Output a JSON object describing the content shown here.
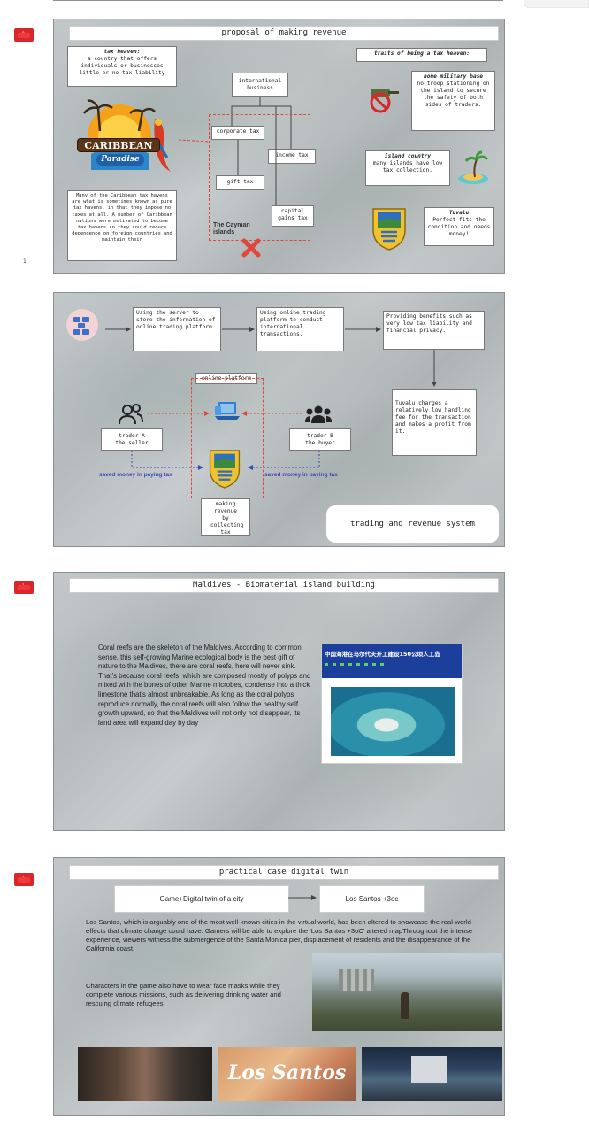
{
  "page": {
    "top_rule": ""
  },
  "slide1": {
    "flag_number": "8",
    "side_mark": "1",
    "title": "proposal of making revenue",
    "tax_haven_term": "tax heaven:",
    "tax_haven_def": "a country that offers individuals or businesses little or no tax liability",
    "caribbean_logo_top": "CARIBBEAN",
    "caribbean_logo_bottom": "Paradise",
    "caribbean_text": "Many of the Caribbean tax havens are what is sometimes known as pure tax havens, in that they impose no taxes at all. A number of Caribbean nations were motivated to become tax havens so they could reduce dependence on foreign countries and maintain their",
    "international_business": "international business",
    "corporate_tax": "corporate tax",
    "income_tax": "income tax",
    "gift_tax": "gift tax",
    "capital_gains_tax": "capital gains tax",
    "cayman": "The Cayman islands",
    "traits_title": "traits of being a tax heaven:",
    "military_title": "none military base",
    "military_text": "no troop stationing on the island to secure the safety of both sides of traders.",
    "island_title": "island country",
    "island_text": "many islands have low tax collection.",
    "tuvalu_title": "Tuvalu",
    "tuvalu_text": "Perfect fits the condition and needs money!"
  },
  "slide2": {
    "step1": "Using the server to store the information of online trading platform.",
    "step2": "Using online trading platform to conduct international transactions.",
    "step3": "Providing benefits such as very low tax liability and financial privacy.",
    "step4": "Tuvalu charges a relatively low handling fee for the transaction and makes a profit from it.",
    "online_platform": "online platform",
    "trader_a": "trader A the seller",
    "trader_b": "trader B the buyer",
    "saved_left": "saved money in paying tax",
    "saved_right": "saved money in paying tax",
    "making_revenue": "making revenue by collecting tax",
    "system_label": "trading and revenue system"
  },
  "slide3": {
    "flag_number": "1",
    "title": "Maldives - Biomaterial island building",
    "paragraph": "Coral reefs are the skeleton of the Maldives. According to common sense, this self-growing Marine ecological body is the best gift of nature to the Maldives, there are coral reefs, here will never sink. That's because coral reefs, which are composed mostly of polyps and mixed with the bones of other Marine microbes, condense into a thick limestone that's almost unbreakable. As long as the coral polyps reproduce normally, the coral reefs will also follow the healthy self growth upward, so that the Maldives will not only not disappear, its land area will expand day by day",
    "news_headline": "中国海港在马尔代夫开工建设150公顷人工岛"
  },
  "slide4": {
    "flag_number": "1",
    "title": "practical case digital twin",
    "box_left": "Game+Digital twin of a city",
    "box_right": "Los Santos +3oc",
    "para1": "Los Santos, which is arguably one of the most well-known cities in the virtual world, has been altered to showcase the real-world effects that climate change could have.  Gamers will be able to explore the 'Los Santos +3oC' altered mapThroughout the intense experience, viewers witness the submergence of the Santa Monica pier, displacement of residents and the disappearance of the California coast.",
    "para2": "Characters in the game also have to wear face masks while they complete various missions,  such as delivering drinking water and rescuing climate refugees",
    "banner_text": "Los Santos"
  },
  "colors": {
    "flag": "#d9262b",
    "dash": "#e0463a",
    "saved": "#3b48b8",
    "arrow": "#444444"
  }
}
